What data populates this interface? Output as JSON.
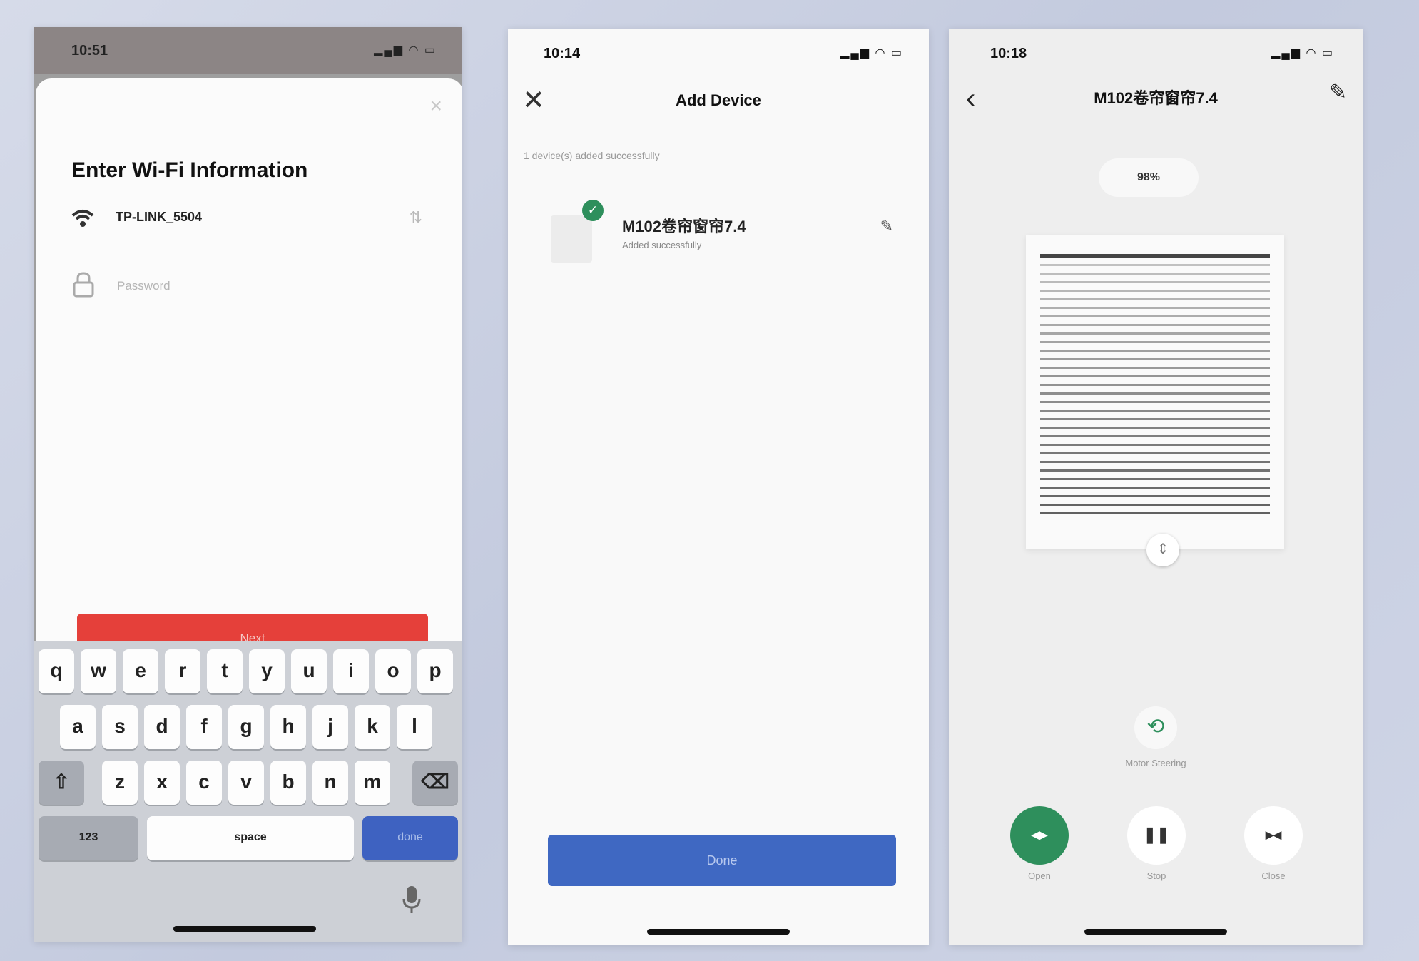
{
  "phone1": {
    "status_time": "10:51",
    "status_icons": "▂▄▆ ◠ ▭",
    "close_label": "×",
    "title": "Enter Wi-Fi Information",
    "wifi_ssid": "TP-LINK_5504",
    "wifi_chevron": "⇅",
    "password_placeholder": "Password",
    "next_label": "Next",
    "keyboard": {
      "row1": [
        "q",
        "w",
        "e",
        "r",
        "t",
        "y",
        "u",
        "i",
        "o",
        "p"
      ],
      "row2": [
        "a",
        "s",
        "d",
        "f",
        "g",
        "h",
        "j",
        "k",
        "l"
      ],
      "row3": [
        "z",
        "x",
        "c",
        "v",
        "b",
        "n",
        "m"
      ],
      "shift": "⇧",
      "backspace": "⌫",
      "num": "123",
      "space": "space",
      "done": "done"
    }
  },
  "phone2": {
    "status_time": "10:14",
    "status_icons": "▂▄▆ ◠ ▭",
    "close_label": "✕",
    "title": "Add Device",
    "subtitle": "1 device(s) added successfully",
    "device_name": "M102卷帘窗帘7.4",
    "device_status": "Added successfully",
    "check": "✓",
    "edit_icon": "✎",
    "done_label": "Done"
  },
  "phone3": {
    "status_time": "10:18",
    "status_icons": "▂▄▆ ◠ ▭",
    "back_label": "‹",
    "title": "M102卷帘窗帘7.4",
    "edit_icon": "✎",
    "percent": "98%",
    "drag_glyph": "⇕",
    "motor_glyph": "⟲",
    "motor_label": "Motor Steering",
    "open_label": "Open",
    "stop_label": "Stop",
    "close_label": "Close",
    "open_glyph": "◂▸",
    "stop_glyph": "❚❚",
    "close_glyph": "▸◂"
  },
  "colors": {
    "accent_red": "#e5403a",
    "accent_blue": "#3f68c2",
    "accent_green": "#2e8f5c"
  }
}
